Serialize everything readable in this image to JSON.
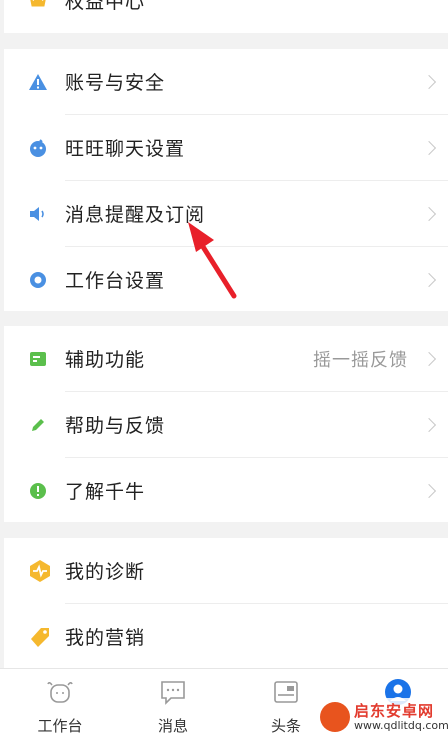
{
  "top_item": {
    "label": "权益中心"
  },
  "section_account": {
    "items": [
      {
        "label": "账号与安全"
      },
      {
        "label": "旺旺聊天设置"
      },
      {
        "label": "消息提醒及订阅"
      },
      {
        "label": "工作台设置"
      }
    ]
  },
  "section_help": {
    "items": [
      {
        "label": "辅助功能",
        "value": "摇一摇反馈"
      },
      {
        "label": "帮助与反馈"
      },
      {
        "label": "了解千牛"
      }
    ]
  },
  "section_tools": {
    "items": [
      {
        "label": "我的诊断"
      },
      {
        "label": "我的营销"
      }
    ]
  },
  "tabbar": {
    "tabs": [
      {
        "label": "工作台"
      },
      {
        "label": "消息"
      },
      {
        "label": "头条"
      }
    ]
  },
  "watermark": {
    "title": "启东安卓网",
    "url": "www.qdlitdq.com"
  },
  "colors": {
    "blue_icon": "#4a90e2",
    "green_icon": "#5bbf4c",
    "gold_icon": "#f5b82e",
    "arrow": "#e8202a"
  }
}
